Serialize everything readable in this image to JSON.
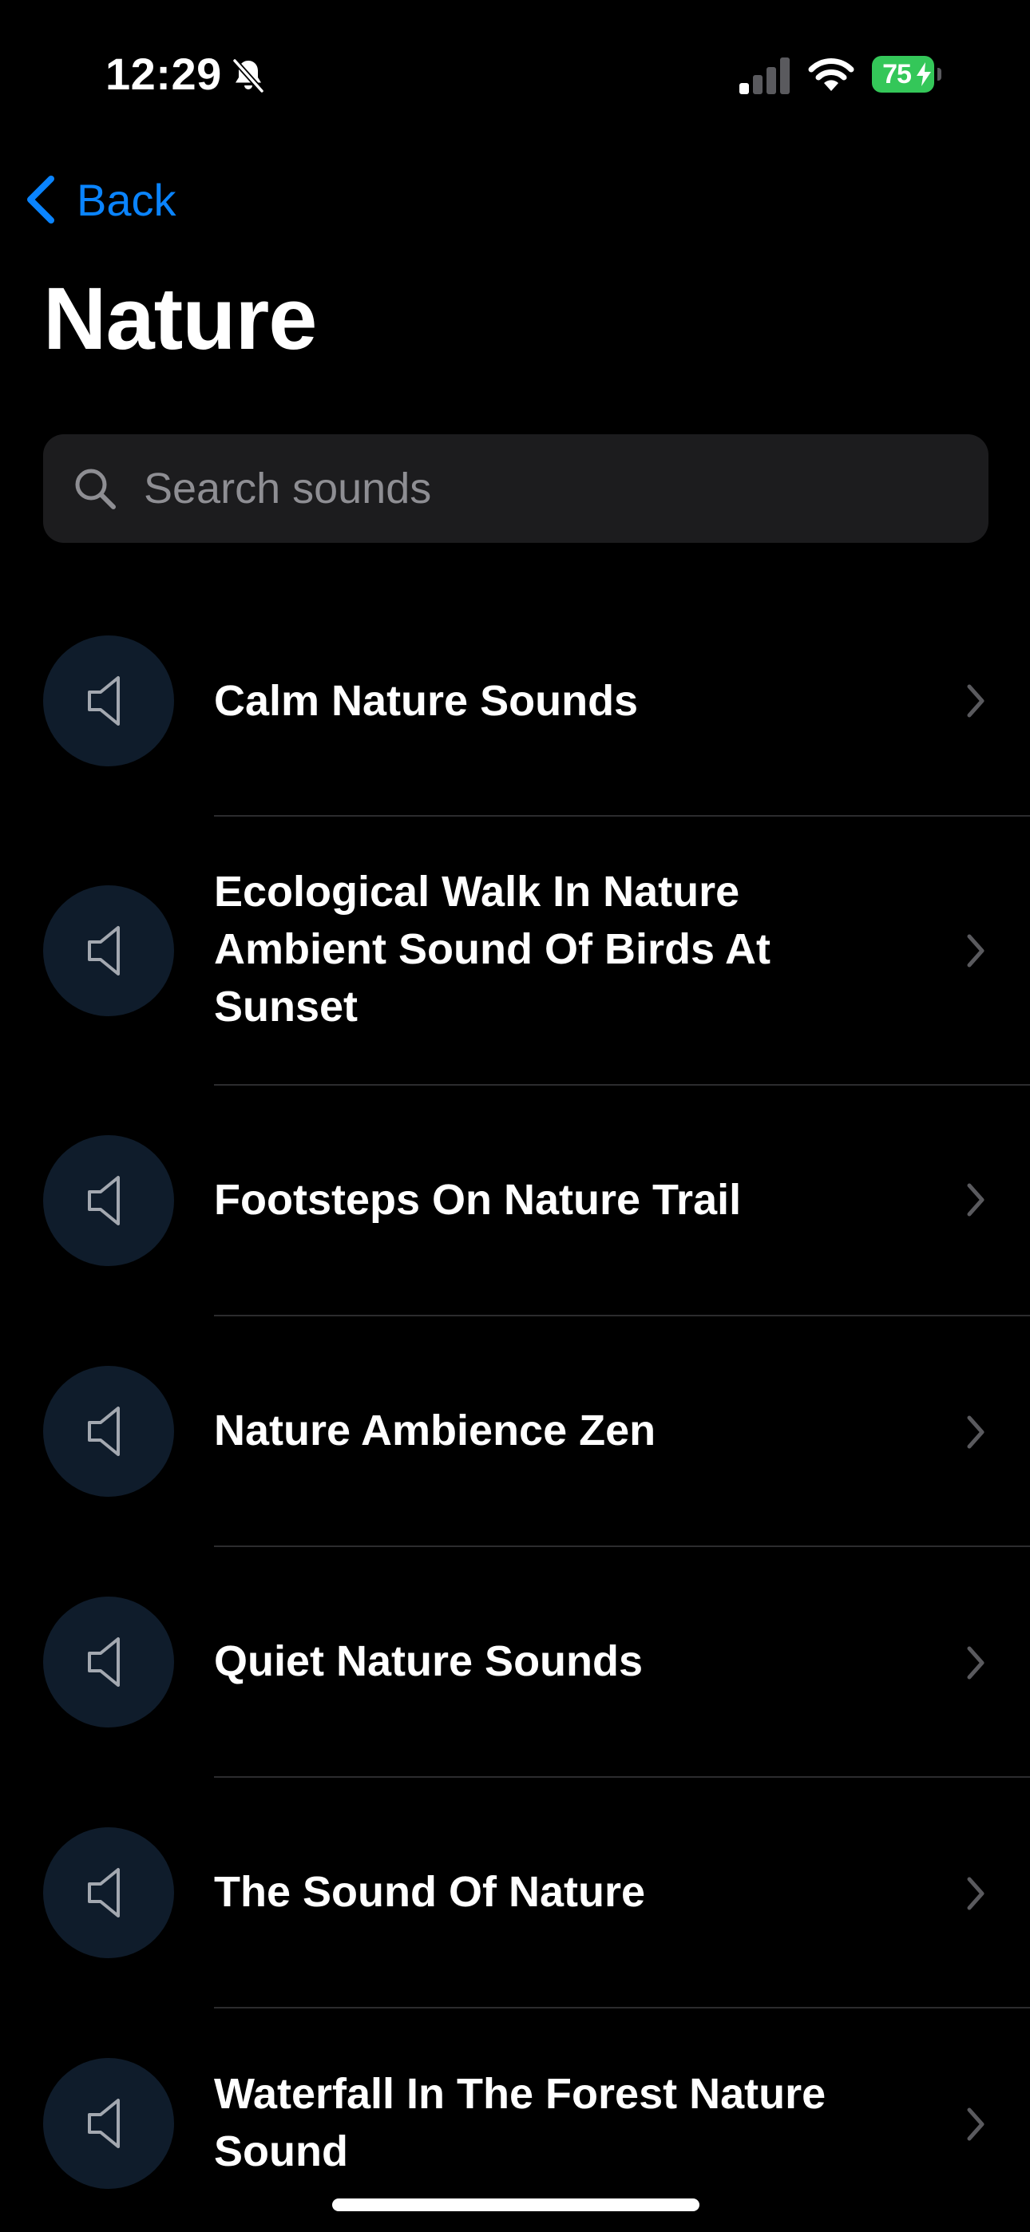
{
  "status_bar": {
    "time": "12:29",
    "battery_percent": "75",
    "battery_color": "#34c759",
    "icons": [
      "bell-slash-icon",
      "cellular-signal-icon",
      "wifi-icon",
      "battery-icon",
      "bolt-icon"
    ]
  },
  "nav": {
    "back_label": "Back",
    "accent_color": "#0a84ff"
  },
  "page": {
    "title": "Nature"
  },
  "search": {
    "placeholder": "Search sounds",
    "value": ""
  },
  "sounds": {
    "items": [
      {
        "title": "Calm Nature Sounds"
      },
      {
        "title": "Ecological Walk In Nature Ambient Sound Of Birds At Sunset"
      },
      {
        "title": "Footsteps On Nature Trail"
      },
      {
        "title": "Nature Ambience Zen"
      },
      {
        "title": "Quiet Nature Sounds"
      },
      {
        "title": "The Sound Of Nature"
      },
      {
        "title": "Waterfall In The Forest Nature Sound"
      }
    ]
  }
}
